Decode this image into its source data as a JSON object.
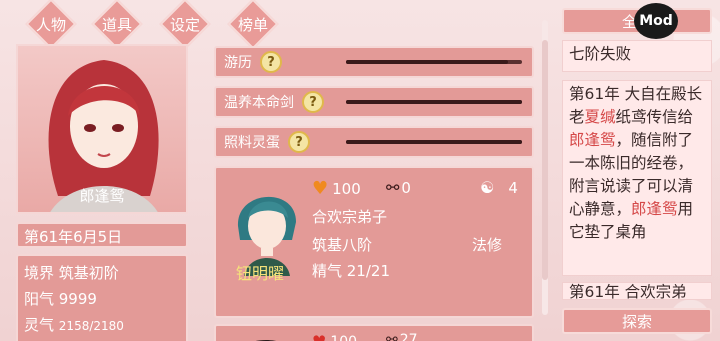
{
  "tabs": [
    {
      "label": "人物"
    },
    {
      "label": "道具"
    },
    {
      "label": "设定"
    },
    {
      "label": "榜单"
    }
  ],
  "character": {
    "name": "郎逢鸳",
    "date": "第61年6月5日",
    "realm": "境界 筑基初阶",
    "yang": "阳气 9999",
    "spirit_label": "灵气",
    "spirit_value": "2158/2180"
  },
  "actions": [
    {
      "label": "游历",
      "progress": 0.92
    },
    {
      "label": "温养本命剑",
      "progress": 1.0
    },
    {
      "label": "照料灵蛋",
      "progress": 1.0
    }
  ],
  "disciple": {
    "name": "钮明曜",
    "affection": "100",
    "bond": "0",
    "yinyang": "4",
    "sect": "合欢宗弟子",
    "realm": "筑基八阶",
    "path": "法修",
    "essence": "精气 21/21"
  },
  "disciple_next": {
    "affection": "100",
    "bond": "27"
  },
  "log": {
    "all_button": "全部",
    "mod_badge": "Mod",
    "entry1": "七阶失败",
    "entry2_p1": "第61年 大自在殿长老",
    "entry2_hl1": "夏缄",
    "entry2_p2": "纸鸢传信给",
    "entry2_hl2": "郎逢鸳",
    "entry2_p3": "，随信附了一本陈旧的经卷，附言说读了可以清心静意，",
    "entry2_hl3": "郎逢鸳",
    "entry2_p4": "用它垫了桌角",
    "entry3": "第61年 合欢宗弟",
    "search_button": "探索"
  },
  "colors": {
    "panel": "#e39a97",
    "border": "#f5d7d6",
    "highlight": "#d54848",
    "log_bg": "#ffe9e9"
  }
}
